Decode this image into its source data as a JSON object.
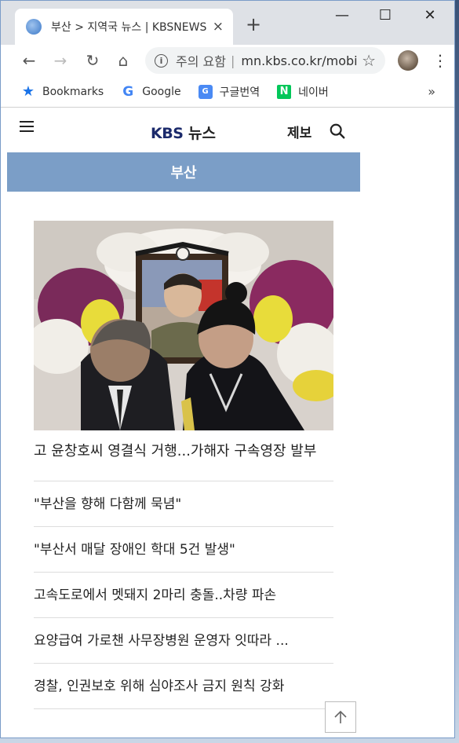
{
  "browser": {
    "tab_title": "부산 > 지역국 뉴스 | KBSNEWS",
    "tab_close": "×",
    "new_tab": "+",
    "controls": {
      "minimize": "—",
      "maximize": "☐",
      "close": "✕"
    },
    "omnibox": {
      "warning": "주의 요함",
      "separator": "|",
      "url": "mn.kbs.co.kr/mobile/index.html"
    },
    "bookmarks": [
      {
        "label": "Bookmarks",
        "icon": "star-icon"
      },
      {
        "label": "Google",
        "icon": "google-icon",
        "glyph": "G"
      },
      {
        "label": "구글번역",
        "icon": "translate-icon",
        "glyph": "G"
      },
      {
        "label": "네이버",
        "icon": "naver-icon",
        "glyph": "N"
      }
    ],
    "bookmarks_more": "»"
  },
  "site": {
    "logo_kbs": "KBS",
    "logo_news": "뉴스",
    "report": "제보",
    "region": "부산"
  },
  "news": {
    "main_headline": "고 윤창호씨 영결식 거행...가해자 구속영장 발부",
    "items": [
      "\"부산을 향해 다함께 묵념\"",
      "\"부산서 매달 장애인 학대 5건 발생\"",
      "고속도로에서 멧돼지 2마리 충돌..차량 파손",
      "요양급여 가로챈 사무장병원 운영자 잇따라 ...",
      "경찰, 인권보호 위해 심야조사 금지 원칙 강화"
    ]
  },
  "colors": {
    "region_bar": "#7b9ec7",
    "kbs_logo": "#1b2a6b",
    "naver_green": "#03c75a"
  }
}
